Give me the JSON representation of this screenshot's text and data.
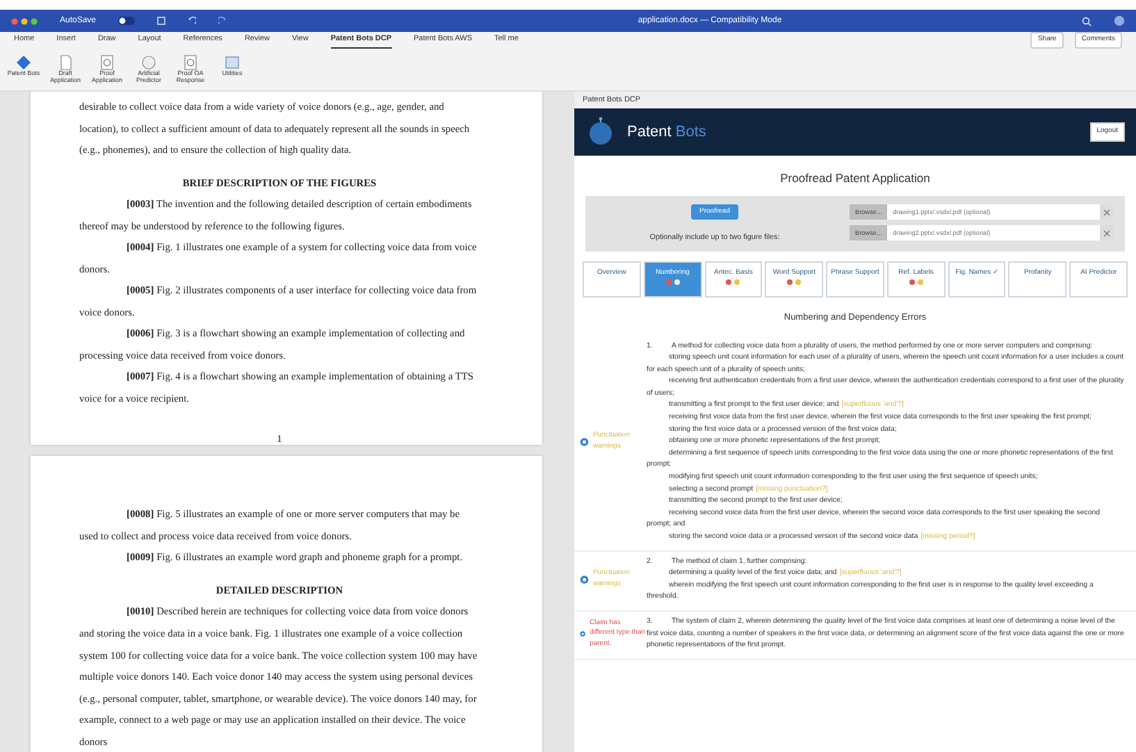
{
  "titlebar": {
    "autosave": "AutoSave",
    "title": "application.docx — Compatibility Mode"
  },
  "ribbon_tabs": [
    {
      "label": "Home",
      "selected": false
    },
    {
      "label": "Insert",
      "selected": false
    },
    {
      "label": "Draw",
      "selected": false
    },
    {
      "label": "Layout",
      "selected": false
    },
    {
      "label": "References",
      "selected": false
    },
    {
      "label": "Review",
      "selected": false
    },
    {
      "label": "View",
      "selected": false
    },
    {
      "label": "Patent Bots DCP",
      "selected": true
    },
    {
      "label": "Patent Bots AWS",
      "selected": false
    },
    {
      "label": "Tell me",
      "selected": false
    }
  ],
  "ribbon_actions": [
    "Share",
    "Comments"
  ],
  "ribbon_buttons": [
    {
      "label": "Patent Bots",
      "kind": "logo"
    },
    {
      "label": "Draft Application",
      "kind": "doc"
    },
    {
      "label": "Proof Application",
      "kind": "magnifier"
    },
    {
      "label": "Artificial Predictor",
      "kind": "circle"
    },
    {
      "label": "Proof OA Response",
      "kind": "magnifier"
    },
    {
      "label": "Utilities",
      "kind": "grid"
    }
  ],
  "document_pages": [
    {
      "paragraphs": [
        {
          "kind": "body",
          "text": "desirable to collect voice data from a wide variety of voice donors (e.g., age, gender, and location), to collect a sufficient amount of data to adequately represent all the sounds in speech (e.g., phonemes), and to ensure the collection of high quality data."
        },
        {
          "kind": "heading",
          "text": "BRIEF DESCRIPTION OF THE FIGURES"
        },
        {
          "kind": "para",
          "text": "**[0003]** The invention and the following detailed description of certain embodiments thereof may be understood by reference to the following figures."
        },
        {
          "kind": "para",
          "text": "**[0004]** Fig. 1 illustrates one example of a system for collecting voice data from voice donors."
        },
        {
          "kind": "para",
          "text": "**[0005]** Fig. 2 illustrates components of a user interface for collecting voice data from voice donors."
        },
        {
          "kind": "para",
          "text": "**[0006]** Fig. 3 is a flowchart showing an example implementation of collecting and processing voice data received from voice donors."
        },
        {
          "kind": "para",
          "text": "**[0007]** Fig. 4 is a flowchart showing an example implementation of obtaining a TTS voice for a voice recipient."
        }
      ],
      "page_number": "1"
    },
    {
      "paragraphs": [
        {
          "kind": "para",
          "text": "**[0008]** Fig. 5 illustrates an example of one or more server computers that may be used to collect and process voice data received from voice donors."
        },
        {
          "kind": "para",
          "text": "**[0009]** Fig. 6 illustrates an example word graph and phoneme graph for a prompt."
        },
        {
          "kind": "heading",
          "text": "DETAILED DESCRIPTION"
        },
        {
          "kind": "para",
          "text": "**[0010]** Described herein are techniques for collecting voice data from voice donors and storing the voice data in a voice bank. Fig. 1 illustrates one example of a voice collection system 100 for collecting voice data for a voice bank. The voice collection system 100 may have multiple voice donors 140. Each voice donor 140 may access the system using personal devices (e.g., personal computer, tablet, smartphone, or wearable device). The voice donors 140 may, for example, connect to a web page or may use an application installed on their device. The voice donors"
        }
      ]
    }
  ],
  "pane": {
    "header": "Patent Bots DCP",
    "brand": [
      "Patent",
      "Bots"
    ],
    "logout": "Logout",
    "title": "Proofread Patent Application",
    "proofread": "Proofread",
    "figure_hint": "Optionally include up to two figure files:",
    "figure_fields": [
      {
        "button": "Browse...",
        "placeholder": "drawing1.pptx/.vsdx/.pdf (optional)"
      },
      {
        "button": "Browse...",
        "placeholder": "drawing2.pptx/.vsdx/.pdf (optional)"
      }
    ],
    "tabs": [
      {
        "label": "Overview",
        "selected": false
      },
      {
        "label": "Numbering",
        "selected": true,
        "marks": [
          {
            "color": "#e0574f"
          },
          {
            "color": "#f2f2f2"
          }
        ]
      },
      {
        "label": "Antec. Basis",
        "selected": false,
        "marks": [
          {
            "color": "#e0574f"
          },
          {
            "color": "#f0c24a"
          }
        ]
      },
      {
        "label": "Word Support",
        "selected": false,
        "marks": [
          {
            "color": "#e0574f"
          },
          {
            "color": "#f0c24a"
          }
        ]
      },
      {
        "label": "Phrase Support",
        "selected": false
      },
      {
        "label": "Ref. Labels",
        "selected": false,
        "marks": [
          {
            "color": "#e0574f"
          },
          {
            "color": "#f0c24a"
          }
        ]
      },
      {
        "label": "Fig. Names ✓",
        "selected": false
      },
      {
        "label": "Profanity",
        "selected": false
      },
      {
        "label": "AI Predictor",
        "selected": false
      }
    ],
    "section_title": "Numbering and Dependency Errors",
    "claims": [
      {
        "note": "Punctuation warnings",
        "kind": "warning",
        "lines": [
          {
            "kind": "preamble",
            "number": "1.",
            "text": "A method for collecting voice data from a plurality of users, the method performed by one or more server computers and comprising:"
          },
          {
            "kind": "element",
            "text": "storing speech unit count information for each user of a plurality of users, wherein the speech unit count information for a user includes a count for each speech unit of a plurality of speech units;"
          },
          {
            "kind": "element",
            "text": "receiving first authentication credentials from a first user device, wherein the authentication credentials correspond to a first user of the plurality of users;"
          },
          {
            "kind": "element",
            "text": "transmitting a first prompt to the first user device; and",
            "flag": "[superfluous 'and'?]"
          },
          {
            "kind": "element",
            "text": "receiving first voice data from the first user device, wherein the first voice data corresponds to the first user speaking the first prompt;"
          },
          {
            "kind": "element",
            "text": "storing the first voice data or a processed version of the first voice data;"
          },
          {
            "kind": "element",
            "text": "obtaining one or more phonetic representations of the first prompt;"
          },
          {
            "kind": "element",
            "text": "determining a first sequence of speech units corresponding to the first voice data using the one or more phonetic representations of the first prompt;"
          },
          {
            "kind": "element",
            "text": "modifying first speech unit count information corresponding to the first user using the first sequence of speech units;"
          },
          {
            "kind": "element",
            "text": "selecting a second prompt",
            "flag": "[missing punctuation?]"
          },
          {
            "kind": "element",
            "text": "transmitting the second prompt to the first user device;"
          },
          {
            "kind": "element",
            "text": "receiving second voice data from the first user device, wherein the second voice data corresponds to the first user speaking the second prompt; and"
          },
          {
            "kind": "element",
            "text": "storing the second voice data or a processed version of the second voice data",
            "flag": "[missing period?]"
          }
        ]
      },
      {
        "note": "Punctuation warnings",
        "kind": "warning",
        "lines": [
          {
            "kind": "preamble",
            "number": "2.",
            "text": "The method of claim 1, further comprising:"
          },
          {
            "kind": "element",
            "text": "determining a quality level of the first voice data; and",
            "flag": "[superfluous 'and'?]"
          },
          {
            "kind": "element",
            "text": "wherein modifying the first speech unit count information corresponding to the first user is in response to the quality level exceeding a threshold."
          }
        ]
      },
      {
        "note": "Claim has different type than parent.",
        "kind": "error",
        "lines": [
          {
            "kind": "preamble",
            "number": "3.",
            "text": "The system of claim 2, wherein determining the quality level of the first voice data comprises at least one of determining a noise level of the first voice data, counting a number of speakers in the first voice data, or determining an alignment score of the first voice data against the one or more phonetic representations of the first prompt."
          }
        ]
      }
    ]
  }
}
